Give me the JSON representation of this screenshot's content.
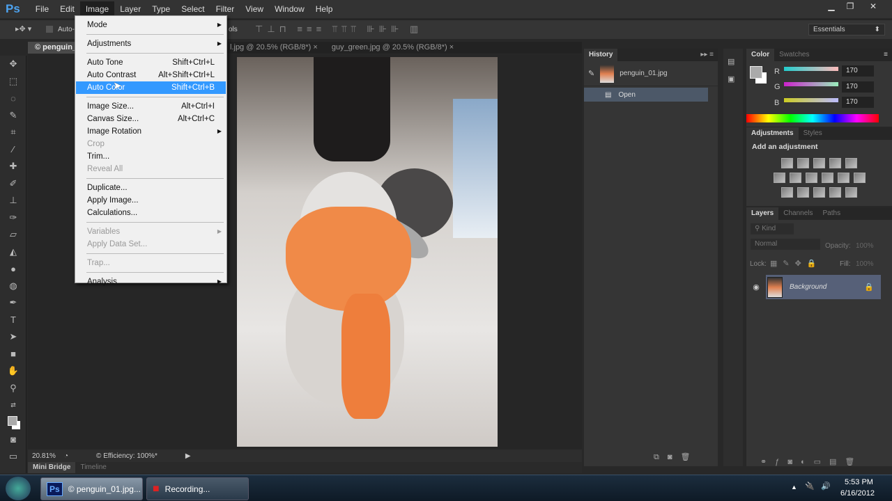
{
  "app": {
    "logo": "Ps"
  },
  "menubar": [
    "File",
    "Edit",
    "Image",
    "Layer",
    "Type",
    "Select",
    "Filter",
    "View",
    "Window",
    "Help"
  ],
  "window_controls": [
    "minimize",
    "restore",
    "close"
  ],
  "options": {
    "auto_select_label": "Auto-",
    "tools_label": "ols",
    "workspace": "Essentials"
  },
  "tabs": [
    {
      "label": "© penguin_",
      "active": true
    },
    {
      "label": "l.jpg @ 20.5% (RGB/8*)",
      "close": "×"
    },
    {
      "label": "guy_green.jpg @ 20.5% (RGB/8*)",
      "close": "×"
    }
  ],
  "image_menu": [
    {
      "label": "Mode",
      "submenu": true
    },
    {
      "sep": true
    },
    {
      "label": "Adjustments",
      "submenu": true
    },
    {
      "sep": true
    },
    {
      "label": "Auto Tone",
      "shortcut": "Shift+Ctrl+L"
    },
    {
      "label": "Auto Contrast",
      "shortcut": "Alt+Shift+Ctrl+L"
    },
    {
      "label": "Auto Color",
      "shortcut": "Shift+Ctrl+B",
      "highlighted": true
    },
    {
      "sep": true
    },
    {
      "label": "Image Size...",
      "shortcut": "Alt+Ctrl+I"
    },
    {
      "label": "Canvas Size...",
      "shortcut": "Alt+Ctrl+C"
    },
    {
      "label": "Image Rotation",
      "submenu": true
    },
    {
      "label": "Crop",
      "disabled": true
    },
    {
      "label": "Trim..."
    },
    {
      "label": "Reveal All",
      "disabled": true
    },
    {
      "sep": true
    },
    {
      "label": "Duplicate..."
    },
    {
      "label": "Apply Image..."
    },
    {
      "label": "Calculations..."
    },
    {
      "sep": true
    },
    {
      "label": "Variables",
      "submenu": true,
      "disabled": true
    },
    {
      "label": "Apply Data Set...",
      "disabled": true
    },
    {
      "sep": true
    },
    {
      "label": "Trap...",
      "disabled": true
    },
    {
      "sep": true
    },
    {
      "label": "Analysis",
      "submenu": true
    }
  ],
  "status": {
    "zoom": "20.81%",
    "info": "© Efficiency: 100%*"
  },
  "bottom_tabs": [
    "Mini Bridge",
    "Timeline"
  ],
  "history": {
    "title": "History",
    "snapshot": "penguin_01.jpg",
    "states": [
      "Open"
    ]
  },
  "color": {
    "tabs": [
      "Color",
      "Swatches"
    ],
    "channels": [
      {
        "label": "R",
        "value": "170"
      },
      {
        "label": "G",
        "value": "170"
      },
      {
        "label": "B",
        "value": "170"
      }
    ],
    "foreground": "#aaaaaa"
  },
  "adjustments": {
    "tabs": [
      "Adjustments",
      "Styles"
    ],
    "heading": "Add an adjustment"
  },
  "layers": {
    "tabs": [
      "Layers",
      "Channels",
      "Paths"
    ],
    "filter": "Kind",
    "blend_mode": "Normal",
    "opacity_label": "Opacity:",
    "opacity": "100%",
    "lock_label": "Lock:",
    "fill_label": "Fill:",
    "fill": "100%",
    "items": [
      {
        "name": "Background",
        "locked": true,
        "visible": true
      }
    ]
  },
  "taskbar": {
    "items": [
      "© penguin_01.jpg...",
      "Recording..."
    ],
    "time": "5:53 PM",
    "date": "6/16/2012"
  }
}
